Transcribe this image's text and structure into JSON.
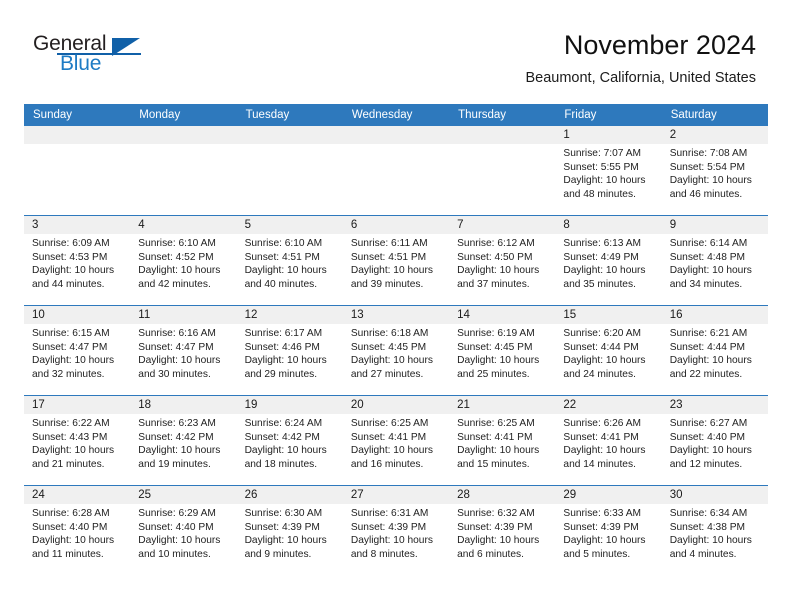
{
  "brand": {
    "name_part1": "General",
    "name_part2": "Blue",
    "accent_color": "#1e7bc4",
    "logo_dark_color": "#1060a8"
  },
  "header": {
    "month_title": "November 2024",
    "location": "Beaumont, California, United States",
    "header_bg_color": "#2e79bd",
    "date_band_color": "#f0f0f0"
  },
  "weekday_headers": [
    "Sunday",
    "Monday",
    "Tuesday",
    "Wednesday",
    "Thursday",
    "Friday",
    "Saturday"
  ],
  "labels": {
    "sunrise_prefix": "Sunrise:",
    "sunset_prefix": "Sunset:",
    "daylight_prefix": "Daylight:"
  },
  "weeks": [
    [
      {
        "date": "",
        "empty": true,
        "line1": "",
        "line2": "",
        "line3": "",
        "line4": ""
      },
      {
        "date": "",
        "empty": true,
        "line1": "",
        "line2": "",
        "line3": "",
        "line4": ""
      },
      {
        "date": "",
        "empty": true,
        "line1": "",
        "line2": "",
        "line3": "",
        "line4": ""
      },
      {
        "date": "",
        "empty": true,
        "line1": "",
        "line2": "",
        "line3": "",
        "line4": ""
      },
      {
        "date": "",
        "empty": true,
        "line1": "",
        "line2": "",
        "line3": "",
        "line4": ""
      },
      {
        "date": "1",
        "empty": false,
        "line1": "Sunrise: 7:07 AM",
        "line2": "Sunset: 5:55 PM",
        "line3": "Daylight: 10 hours",
        "line4": "and 48 minutes."
      },
      {
        "date": "2",
        "empty": false,
        "line1": "Sunrise: 7:08 AM",
        "line2": "Sunset: 5:54 PM",
        "line3": "Daylight: 10 hours",
        "line4": "and 46 minutes."
      }
    ],
    [
      {
        "date": "3",
        "empty": false,
        "line1": "Sunrise: 6:09 AM",
        "line2": "Sunset: 4:53 PM",
        "line3": "Daylight: 10 hours",
        "line4": "and 44 minutes."
      },
      {
        "date": "4",
        "empty": false,
        "line1": "Sunrise: 6:10 AM",
        "line2": "Sunset: 4:52 PM",
        "line3": "Daylight: 10 hours",
        "line4": "and 42 minutes."
      },
      {
        "date": "5",
        "empty": false,
        "line1": "Sunrise: 6:10 AM",
        "line2": "Sunset: 4:51 PM",
        "line3": "Daylight: 10 hours",
        "line4": "and 40 minutes."
      },
      {
        "date": "6",
        "empty": false,
        "line1": "Sunrise: 6:11 AM",
        "line2": "Sunset: 4:51 PM",
        "line3": "Daylight: 10 hours",
        "line4": "and 39 minutes."
      },
      {
        "date": "7",
        "empty": false,
        "line1": "Sunrise: 6:12 AM",
        "line2": "Sunset: 4:50 PM",
        "line3": "Daylight: 10 hours",
        "line4": "and 37 minutes."
      },
      {
        "date": "8",
        "empty": false,
        "line1": "Sunrise: 6:13 AM",
        "line2": "Sunset: 4:49 PM",
        "line3": "Daylight: 10 hours",
        "line4": "and 35 minutes."
      },
      {
        "date": "9",
        "empty": false,
        "line1": "Sunrise: 6:14 AM",
        "line2": "Sunset: 4:48 PM",
        "line3": "Daylight: 10 hours",
        "line4": "and 34 minutes."
      }
    ],
    [
      {
        "date": "10",
        "empty": false,
        "line1": "Sunrise: 6:15 AM",
        "line2": "Sunset: 4:47 PM",
        "line3": "Daylight: 10 hours",
        "line4": "and 32 minutes."
      },
      {
        "date": "11",
        "empty": false,
        "line1": "Sunrise: 6:16 AM",
        "line2": "Sunset: 4:47 PM",
        "line3": "Daylight: 10 hours",
        "line4": "and 30 minutes."
      },
      {
        "date": "12",
        "empty": false,
        "line1": "Sunrise: 6:17 AM",
        "line2": "Sunset: 4:46 PM",
        "line3": "Daylight: 10 hours",
        "line4": "and 29 minutes."
      },
      {
        "date": "13",
        "empty": false,
        "line1": "Sunrise: 6:18 AM",
        "line2": "Sunset: 4:45 PM",
        "line3": "Daylight: 10 hours",
        "line4": "and 27 minutes."
      },
      {
        "date": "14",
        "empty": false,
        "line1": "Sunrise: 6:19 AM",
        "line2": "Sunset: 4:45 PM",
        "line3": "Daylight: 10 hours",
        "line4": "and 25 minutes."
      },
      {
        "date": "15",
        "empty": false,
        "line1": "Sunrise: 6:20 AM",
        "line2": "Sunset: 4:44 PM",
        "line3": "Daylight: 10 hours",
        "line4": "and 24 minutes."
      },
      {
        "date": "16",
        "empty": false,
        "line1": "Sunrise: 6:21 AM",
        "line2": "Sunset: 4:44 PM",
        "line3": "Daylight: 10 hours",
        "line4": "and 22 minutes."
      }
    ],
    [
      {
        "date": "17",
        "empty": false,
        "line1": "Sunrise: 6:22 AM",
        "line2": "Sunset: 4:43 PM",
        "line3": "Daylight: 10 hours",
        "line4": "and 21 minutes."
      },
      {
        "date": "18",
        "empty": false,
        "line1": "Sunrise: 6:23 AM",
        "line2": "Sunset: 4:42 PM",
        "line3": "Daylight: 10 hours",
        "line4": "and 19 minutes."
      },
      {
        "date": "19",
        "empty": false,
        "line1": "Sunrise: 6:24 AM",
        "line2": "Sunset: 4:42 PM",
        "line3": "Daylight: 10 hours",
        "line4": "and 18 minutes."
      },
      {
        "date": "20",
        "empty": false,
        "line1": "Sunrise: 6:25 AM",
        "line2": "Sunset: 4:41 PM",
        "line3": "Daylight: 10 hours",
        "line4": "and 16 minutes."
      },
      {
        "date": "21",
        "empty": false,
        "line1": "Sunrise: 6:25 AM",
        "line2": "Sunset: 4:41 PM",
        "line3": "Daylight: 10 hours",
        "line4": "and 15 minutes."
      },
      {
        "date": "22",
        "empty": false,
        "line1": "Sunrise: 6:26 AM",
        "line2": "Sunset: 4:41 PM",
        "line3": "Daylight: 10 hours",
        "line4": "and 14 minutes."
      },
      {
        "date": "23",
        "empty": false,
        "line1": "Sunrise: 6:27 AM",
        "line2": "Sunset: 4:40 PM",
        "line3": "Daylight: 10 hours",
        "line4": "and 12 minutes."
      }
    ],
    [
      {
        "date": "24",
        "empty": false,
        "line1": "Sunrise: 6:28 AM",
        "line2": "Sunset: 4:40 PM",
        "line3": "Daylight: 10 hours",
        "line4": "and 11 minutes."
      },
      {
        "date": "25",
        "empty": false,
        "line1": "Sunrise: 6:29 AM",
        "line2": "Sunset: 4:40 PM",
        "line3": "Daylight: 10 hours",
        "line4": "and 10 minutes."
      },
      {
        "date": "26",
        "empty": false,
        "line1": "Sunrise: 6:30 AM",
        "line2": "Sunset: 4:39 PM",
        "line3": "Daylight: 10 hours",
        "line4": "and 9 minutes."
      },
      {
        "date": "27",
        "empty": false,
        "line1": "Sunrise: 6:31 AM",
        "line2": "Sunset: 4:39 PM",
        "line3": "Daylight: 10 hours",
        "line4": "and 8 minutes."
      },
      {
        "date": "28",
        "empty": false,
        "line1": "Sunrise: 6:32 AM",
        "line2": "Sunset: 4:39 PM",
        "line3": "Daylight: 10 hours",
        "line4": "and 6 minutes."
      },
      {
        "date": "29",
        "empty": false,
        "line1": "Sunrise: 6:33 AM",
        "line2": "Sunset: 4:39 PM",
        "line3": "Daylight: 10 hours",
        "line4": "and 5 minutes."
      },
      {
        "date": "30",
        "empty": false,
        "line1": "Sunrise: 6:34 AM",
        "line2": "Sunset: 4:38 PM",
        "line3": "Daylight: 10 hours",
        "line4": "and 4 minutes."
      }
    ]
  ]
}
